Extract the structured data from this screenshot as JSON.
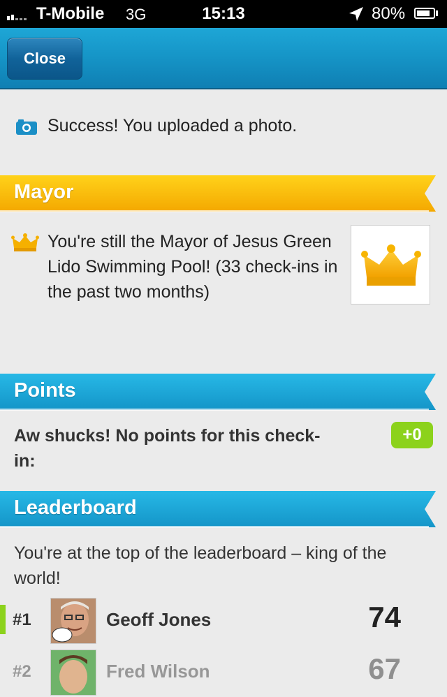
{
  "status_bar": {
    "carrier": "T-Mobile",
    "network": "3G",
    "time": "15:13",
    "battery_percent_text": "80%",
    "battery_level": 0.8
  },
  "nav": {
    "close_label": "Close"
  },
  "success": {
    "message": "Success! You uploaded a photo."
  },
  "mayor": {
    "title": "Mayor",
    "message": "You're still the Mayor of Jesus Green Lido Swimming Pool! (33 check-ins in the past two months)",
    "color": "#f5b800"
  },
  "points": {
    "title": "Points",
    "message": "Aw shucks! No points for this check-in:",
    "badge": "+0",
    "color": "#1aa9d9"
  },
  "leaderboard": {
    "title": "Leaderboard",
    "message": "You're at the top of the leaderboard – king of the world!",
    "rows": [
      {
        "rank": "#1",
        "name": "Geoff Jones",
        "score": "74"
      },
      {
        "rank": "#2",
        "name": "Fred Wilson",
        "score": "67"
      }
    ]
  }
}
